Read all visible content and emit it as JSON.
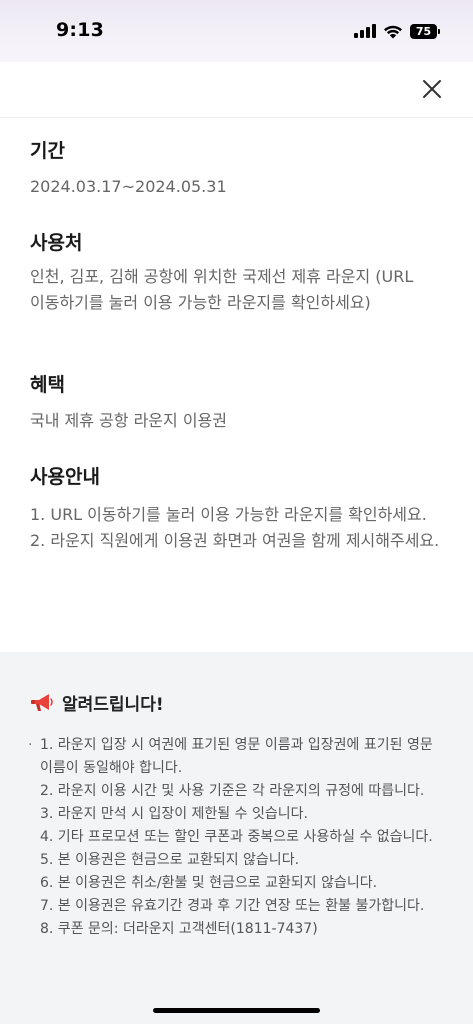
{
  "status_bar": {
    "time": "9:13",
    "battery": "75"
  },
  "header": {
    "close_icon": "close-icon"
  },
  "sections": {
    "period": {
      "title": "기간",
      "body": "2024.03.17~2024.05.31"
    },
    "place": {
      "title": "사용처",
      "body": "인천, 김포, 김해 공항에 위치한 국제선 제휴 라운지 (URL 이동하기를 눌러 이용 가능한 라운지를 확인하세요)"
    },
    "benefit": {
      "title": "혜택",
      "body": "국내 제휴 공항 라운지 이용권"
    },
    "guide": {
      "title": "사용안내",
      "items": [
        "1. URL 이동하기를 눌러 이용 가능한 라운지를 확인하세요.",
        "2. 라운지 직원에게 이용권 화면과 여권을 함께 제시해주세요."
      ]
    }
  },
  "notice": {
    "icon": "megaphone-icon",
    "title": "알려드립니다!",
    "items": [
      "1. 라운지 입장 시 여권에 표기된 영문 이름과 입장권에 표기된 영문 이름이 동일해야 합니다.",
      "2. 라운지 이용 시간 및 사용 기준은 각 라운지의 규정에 따릅니다.",
      "3. 라운지 만석 시 입장이 제한될 수 잇습니다.",
      "4. 기타 프로모션 또는 할인 쿠폰과 중복으로 사용하실 수 없습니다.",
      "5. 본 이용권은 현금으로 교환되지 않습니다.",
      "6. 본 이용권은 취소/환불 및 현금으로 교환되지 않습니다.",
      "7. 본 이용권은 유효기간 경과 후 기간 연장 또는 환불 불가합니다.",
      "8. 쿠폰 문의: 더라운지 고객센터(1811-7437)"
    ]
  },
  "colors": {
    "notice_bg": "#f2f4f5",
    "body_text": "#666666",
    "title_text": "#1a1a1a",
    "megaphone_red": "#e8413a"
  }
}
